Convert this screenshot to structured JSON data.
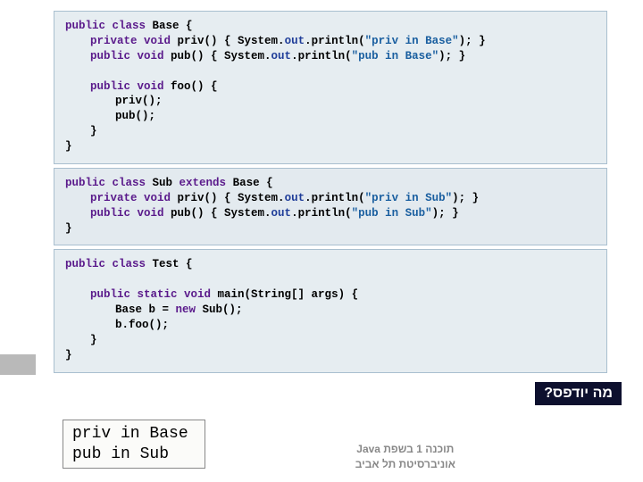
{
  "code": {
    "base": {
      "decl_pre": "public class ",
      "name": "Base",
      "decl_post": " {",
      "m1_pre": "private void ",
      "m1_name": "priv",
      "m1_args": "() { System.",
      "m1_out": "out",
      "m1_call": ".println(",
      "m1_str": "\"priv in Base\"",
      "m1_end": "); }",
      "m2_pre": "public void ",
      "m2_name": "pub",
      "m2_args": "() { System.",
      "m2_out": "out",
      "m2_call": ".println(",
      "m2_str": "\"pub in Base\"",
      "m2_end": "); }",
      "foo_pre": "public void ",
      "foo_name": "foo",
      "foo_args": "() {",
      "foo_b1": "priv();",
      "foo_b2": "pub();",
      "foo_close": "}",
      "class_close": "}"
    },
    "sub": {
      "decl_pre": "public class ",
      "name": "Sub",
      "extends_kw": " extends ",
      "parent": "Base",
      "decl_post": " {",
      "m1_pre": "private void ",
      "m1_name": "priv",
      "m1_args": "() { System.",
      "m1_out": "out",
      "m1_call": ".println(",
      "m1_str": "\"priv in Sub\"",
      "m1_end": "); }",
      "m2_pre": "public void ",
      "m2_name": "pub",
      "m2_args": "() { System.",
      "m2_out": "out",
      "m2_call": ".println(",
      "m2_str": "\"pub in Sub\"",
      "m2_end": "); }",
      "class_close": "}"
    },
    "test": {
      "decl_pre": "public class ",
      "name": "Test",
      "decl_post": " {",
      "main_pre": "public static void ",
      "main_name": "main",
      "main_args": "(String[] args) {",
      "b1_pre": "Base b = ",
      "b1_new": "new",
      "b1_post": " Sub();",
      "b2": "b.foo();",
      "close1": "}",
      "class_close": "}"
    }
  },
  "output": {
    "l1": "priv in Base",
    "l2": "pub in Sub"
  },
  "question": "מה יודפס?",
  "footer": {
    "l1": "תוכנה 1 בשפת Java",
    "l2": "אוניברסיטת תל אביב"
  }
}
